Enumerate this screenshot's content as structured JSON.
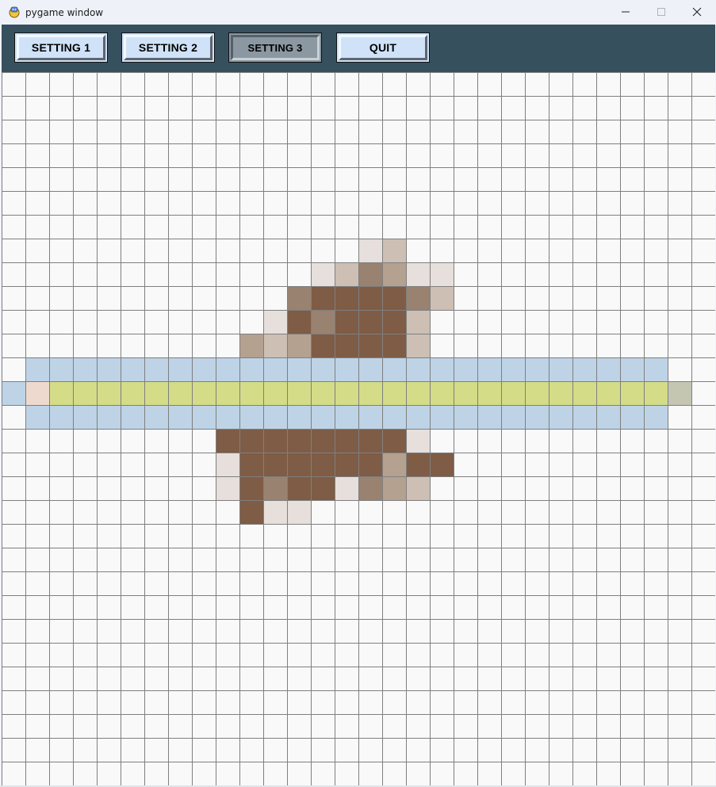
{
  "window": {
    "title": "pygame window",
    "controls": {
      "minimize_icon": "minimize-icon",
      "maximize_icon": "maximize-icon",
      "close_icon": "close-icon"
    }
  },
  "toolbar": {
    "background": "#36505e",
    "buttons": [
      {
        "label": "SETTING 1",
        "active": false
      },
      {
        "label": "SETTING 2",
        "active": false
      },
      {
        "label": "SETTING 3",
        "active": true
      },
      {
        "label": "QUIT",
        "active": false
      }
    ]
  },
  "grid": {
    "columns": 30,
    "rows": 30,
    "background": "#f9f9f9",
    "line_color": "#7f7f7f",
    "palette": {
      "a": "#e6dfdb",
      "b": "#cdbfb4",
      "c": "#b4a190",
      "d": "#9a8270",
      "e": "#7f5c45",
      "f": "#bed3e6",
      "g": "#d4dc88",
      "h": "#eed9ce",
      "i": "#c4c6b2"
    },
    "rows_map": [
      "..............................",
      "..............................",
      "..............................",
      "..............................",
      "..............................",
      "..............................",
      "..............................",
      "...............ab.............",
      ".............abdcaa...........",
      "............deeeedb...........",
      "...........aedeeeb............",
      "..........cbceeeeb............",
      ".fffffffffffffffffffffffffff..",
      "fhggggggggggggggggggggggggggi.",
      ".fffffffffffffffffffffffffff..",
      ".........eeeeeeeea............",
      ".........aeeeeeecee...........",
      ".........aedeeadcb............",
      "..........eaa.................",
      "..............................",
      "..............................",
      "..............................",
      "..............................",
      "..............................",
      "..............................",
      "..............................",
      "..............................",
      "..............................",
      "..............................",
      ".............................."
    ]
  }
}
